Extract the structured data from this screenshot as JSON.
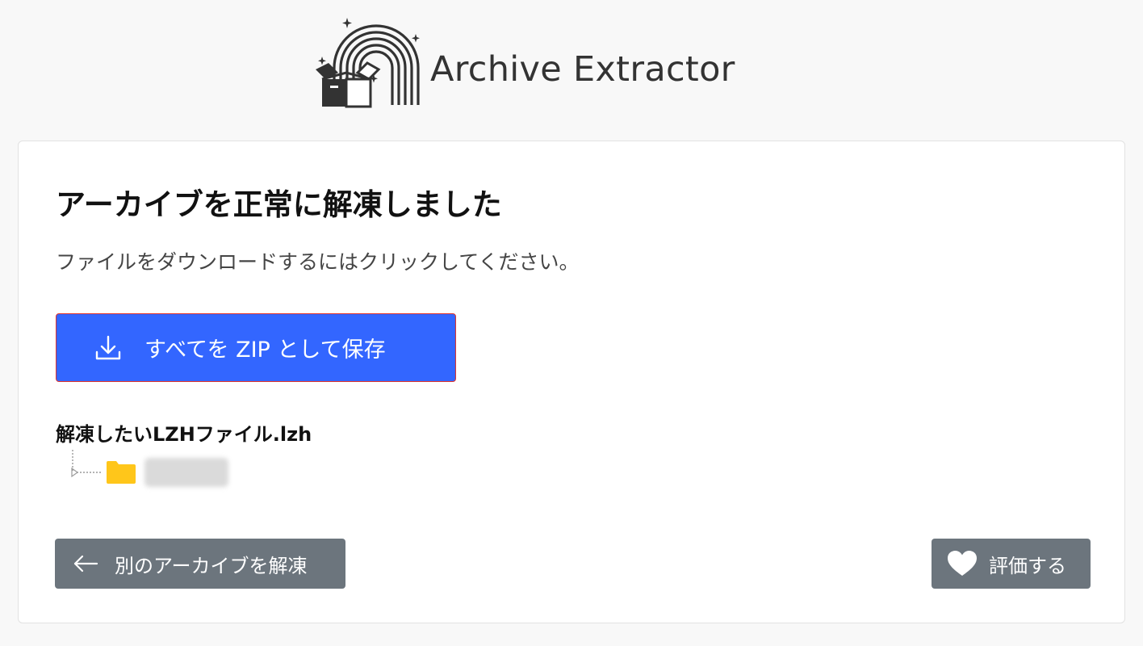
{
  "app": {
    "title": "Archive Extractor",
    "logo_icon": "rainbow-box-logo-icon"
  },
  "result": {
    "heading": "アーカイブを正常に解凍しました",
    "subtitle": "ファイルをダウンロードするにはクリックしてください。",
    "save_zip_label": "すべてを ZIP として保存",
    "save_zip_icon": "download-icon"
  },
  "file_tree": {
    "archive_name": "解凍したいLZHファイル.lzh",
    "items": [
      {
        "type": "folder",
        "icon": "folder-icon",
        "name": "",
        "name_redacted": true
      }
    ]
  },
  "footer": {
    "back_label": "別のアーカイブを解凍",
    "back_icon": "arrow-left-icon",
    "rate_label": "評価する",
    "rate_icon": "heart-icon"
  },
  "colors": {
    "primary": "#3366ff",
    "secondary": "#6c757d",
    "folder": "#ffc61a",
    "background": "#f8f8f8"
  }
}
